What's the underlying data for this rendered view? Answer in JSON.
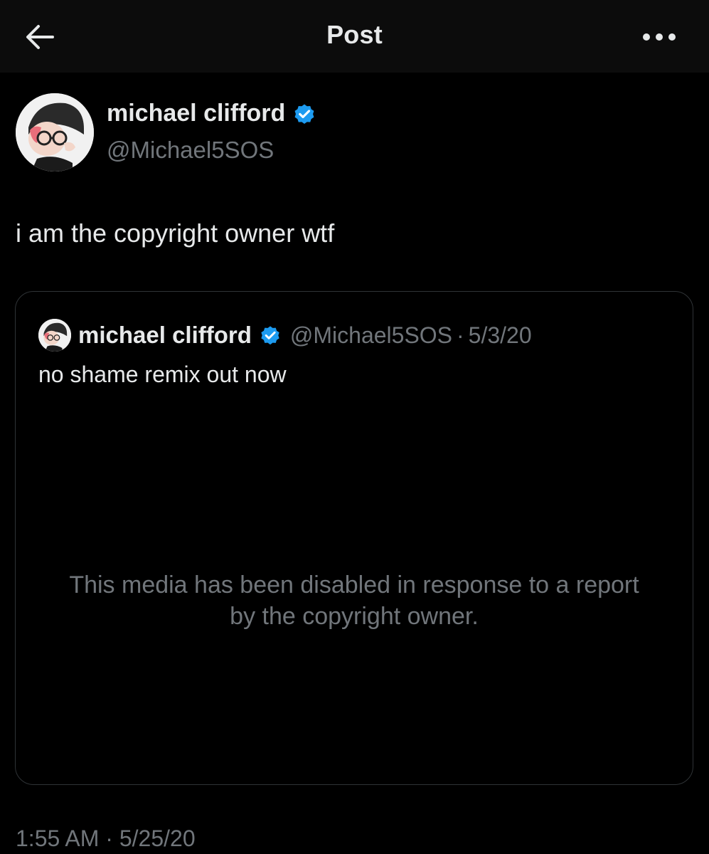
{
  "header": {
    "title": "Post",
    "back_icon": "arrow-left-icon",
    "more_icon": "more-horizontal-icon"
  },
  "post": {
    "author_name": "michael clifford",
    "author_handle": "@Michael5SOS",
    "verified_icon": "verified-badge-icon",
    "text": "i am the copyright owner wtf",
    "timestamp": "1:55 AM · 5/25/20"
  },
  "quoted_post": {
    "author_name": "michael clifford",
    "author_handle": "@Michael5SOS",
    "separator": "·",
    "date": "5/3/20",
    "text": "no shame remix out now",
    "media_notice": "This media has been disabled in response to a report by the copyright owner."
  },
  "colors": {
    "background": "#000000",
    "topbar": "#0c0c0c",
    "primary_text": "#e7e9ea",
    "secondary_text": "#71767b",
    "verified_blue": "#1d9bf0",
    "border": "#2f3336"
  }
}
